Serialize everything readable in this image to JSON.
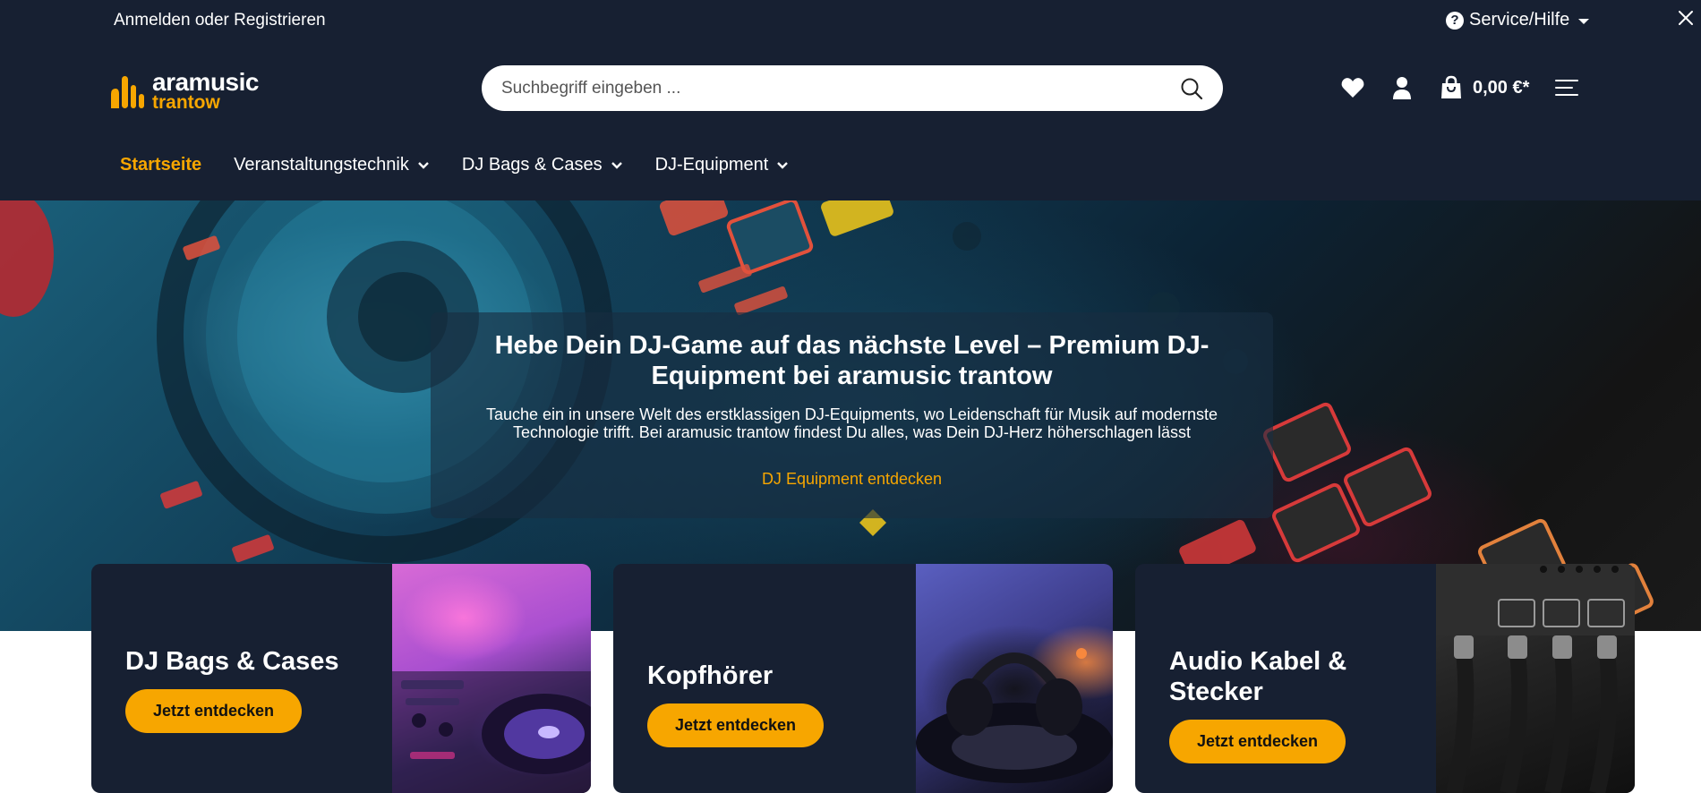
{
  "topbar": {
    "login_text": "Anmelden oder Registrieren",
    "service_label": "Service/Hilfe",
    "help_icon_glyph": "?"
  },
  "logo": {
    "line1": "aramusic",
    "line2": "trantow"
  },
  "search": {
    "placeholder": "Suchbegriff eingeben ..."
  },
  "header_actions": {
    "icons": [
      "heart-icon",
      "user-icon",
      "shopping-bag-icon",
      "menu-icon"
    ],
    "cart_total": "0,00 €*"
  },
  "nav": {
    "items": [
      {
        "label": "Startseite",
        "active": true,
        "dropdown": false
      },
      {
        "label": "Veranstaltungstechnik",
        "active": false,
        "dropdown": true
      },
      {
        "label": "DJ Bags & Cases",
        "active": false,
        "dropdown": true
      },
      {
        "label": "DJ-Equipment",
        "active": false,
        "dropdown": true
      }
    ]
  },
  "hero": {
    "title": "Hebe Dein DJ-Game auf das nächste Level – Premium DJ-Equipment bei aramusic trantow",
    "text": "Tauche ein in unsere Welt des erstklassigen DJ-Equipments, wo Leidenschaft für Musik auf modernste Technologie trifft. Bei aramusic trantow findest Du alles, was Dein DJ-Herz höherschlagen lässt",
    "link_label": "DJ Equipment entdecken"
  },
  "cards": [
    {
      "title": "DJ Bags & Cases",
      "button_label": "Jetzt entdecken"
    },
    {
      "title": "Kopfhörer",
      "button_label": "Jetzt entdecken"
    },
    {
      "title": "Audio Kabel & Stecker",
      "button_label": "Jetzt entdecken"
    }
  ],
  "colors": {
    "header_bg": "#172032",
    "accent": "#f7a600",
    "text_light": "#ffffff"
  }
}
